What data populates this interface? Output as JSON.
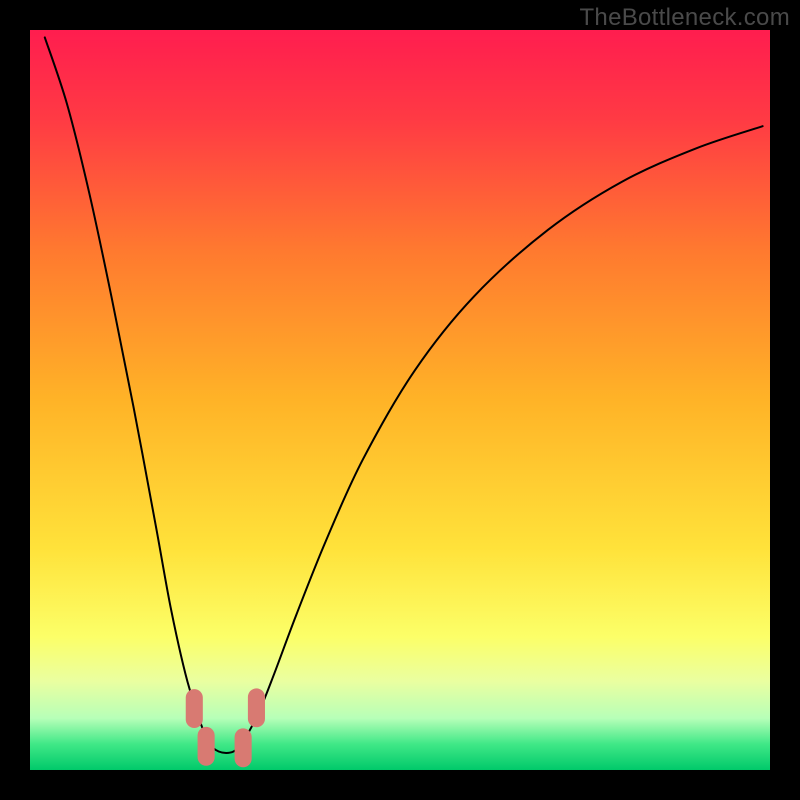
{
  "watermark": "TheBottleneck.com",
  "chart_data": {
    "type": "line",
    "title": "",
    "xlabel": "",
    "ylabel": "",
    "xlim": [
      0,
      100
    ],
    "ylim": [
      0,
      100
    ],
    "background_gradient": {
      "stops": [
        {
          "pos": 0.0,
          "color": "#ff1d4f"
        },
        {
          "pos": 0.12,
          "color": "#ff3a44"
        },
        {
          "pos": 0.3,
          "color": "#ff7a2f"
        },
        {
          "pos": 0.5,
          "color": "#ffb327"
        },
        {
          "pos": 0.7,
          "color": "#ffe23a"
        },
        {
          "pos": 0.82,
          "color": "#fcff68"
        },
        {
          "pos": 0.88,
          "color": "#eaffa0"
        },
        {
          "pos": 0.93,
          "color": "#b7ffb8"
        },
        {
          "pos": 0.965,
          "color": "#40e887"
        },
        {
          "pos": 1.0,
          "color": "#00c96a"
        }
      ]
    },
    "series": [
      {
        "name": "bottleneck-curve",
        "stroke": "#000000",
        "stroke_width": 2,
        "points": [
          {
            "x": 2.0,
            "y": 99.0
          },
          {
            "x": 5.0,
            "y": 90.0
          },
          {
            "x": 8.0,
            "y": 78.0
          },
          {
            "x": 11.0,
            "y": 64.0
          },
          {
            "x": 14.0,
            "y": 49.0
          },
          {
            "x": 17.0,
            "y": 33.0
          },
          {
            "x": 19.0,
            "y": 22.0
          },
          {
            "x": 21.0,
            "y": 13.0
          },
          {
            "x": 22.5,
            "y": 8.0
          },
          {
            "x": 24.0,
            "y": 4.0
          },
          {
            "x": 25.5,
            "y": 2.5
          },
          {
            "x": 27.5,
            "y": 2.5
          },
          {
            "x": 29.0,
            "y": 4.2
          },
          {
            "x": 31.0,
            "y": 8.0
          },
          {
            "x": 33.0,
            "y": 13.0
          },
          {
            "x": 36.0,
            "y": 21.0
          },
          {
            "x": 40.0,
            "y": 31.0
          },
          {
            "x": 45.0,
            "y": 42.0
          },
          {
            "x": 52.0,
            "y": 54.0
          },
          {
            "x": 60.0,
            "y": 64.0
          },
          {
            "x": 70.0,
            "y": 73.0
          },
          {
            "x": 80.0,
            "y": 79.5
          },
          {
            "x": 90.0,
            "y": 84.0
          },
          {
            "x": 99.0,
            "y": 87.0
          }
        ]
      }
    ],
    "markers": [
      {
        "x": 22.2,
        "y": 8.3,
        "color": "#d87a72",
        "r": 2.1
      },
      {
        "x": 23.8,
        "y": 3.2,
        "color": "#d87a72",
        "r": 2.1
      },
      {
        "x": 28.8,
        "y": 3.0,
        "color": "#d87a72",
        "r": 2.1
      },
      {
        "x": 30.6,
        "y": 8.4,
        "color": "#d87a72",
        "r": 2.1
      }
    ]
  }
}
